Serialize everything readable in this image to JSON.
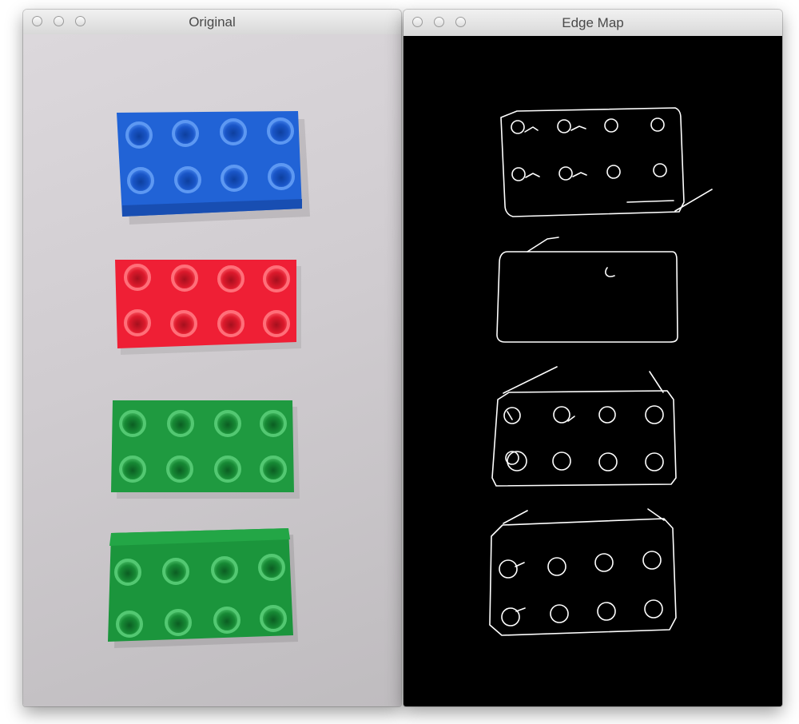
{
  "windows": {
    "original": {
      "title": "Original"
    },
    "edge": {
      "title": "Edge Map"
    }
  },
  "colors": {
    "blue_brick": "#2163d6",
    "red_brick": "#ef1f35",
    "green_brick": "#1f9a40",
    "edge_line": "#ffffff",
    "edge_background": "#000000"
  },
  "bricks": [
    {
      "color": "blue"
    },
    {
      "color": "red"
    },
    {
      "color": "green"
    },
    {
      "color": "green"
    }
  ]
}
